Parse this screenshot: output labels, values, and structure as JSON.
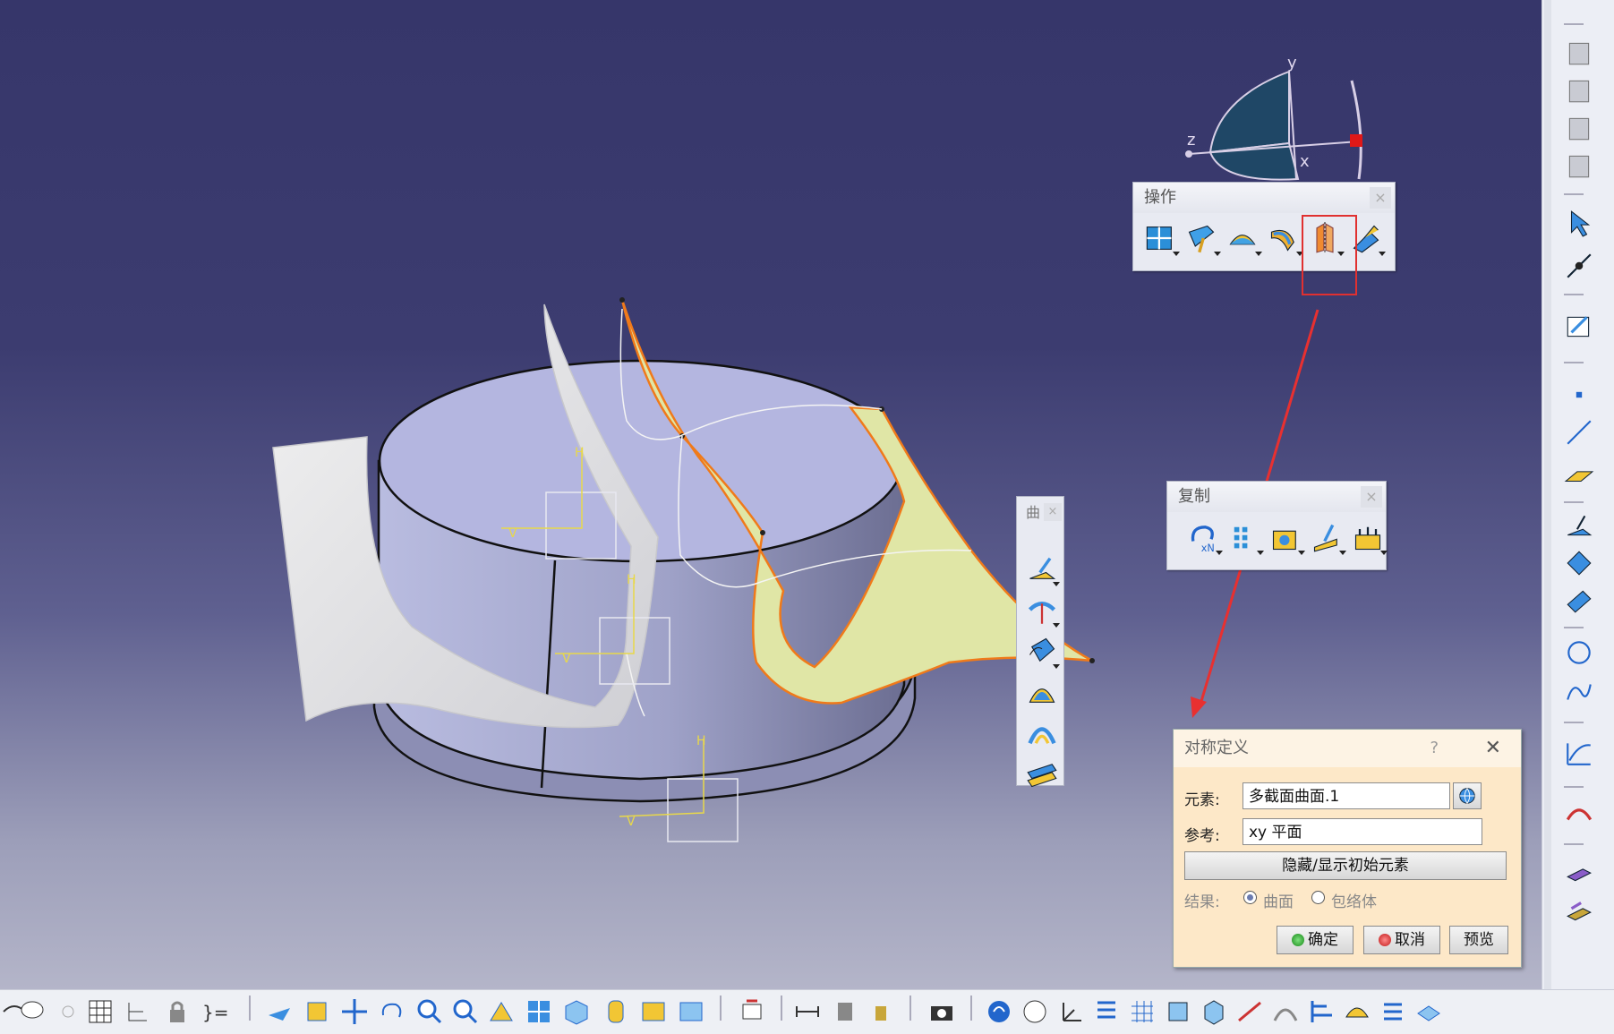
{
  "compass": {
    "y_label": "y",
    "z_label": "z",
    "x_label": "x"
  },
  "toolbars": {
    "operations": {
      "title": "操作",
      "close": "×",
      "icons": [
        "join-icon",
        "healing-icon",
        "extract-icon",
        "fillet-icon",
        "symmetry-icon",
        "transform-icon"
      ]
    },
    "replication": {
      "title": "复制",
      "close": "×",
      "icons": [
        "repetition-icon",
        "pattern-icon",
        "powercopy-icon",
        "instantiate-icon",
        "catalog-icon"
      ]
    },
    "curves": {
      "title": "曲",
      "close": "×",
      "icons": [
        "extrude-surface-icon",
        "revolve-surface-icon",
        "sweep-surface-icon",
        "fill-surface-icon",
        "multisection-surface-icon",
        "blend-surface-icon"
      ]
    }
  },
  "dialog": {
    "title": "对称定义",
    "help": "?",
    "close": "✕",
    "element_label": "元素:",
    "element_value": "多截面曲面.1",
    "reference_label": "参考:",
    "reference_value": "xy 平面",
    "toggle_button": "隐藏/显示初始元素",
    "result_label": "结果:",
    "result_option1": "曲面",
    "result_option2": "包络体",
    "ok_button": "确定",
    "cancel_button": "取消",
    "preview_button": "预览"
  },
  "colors": {
    "highlight": "#e03030",
    "arrow": "#e83030",
    "viewport_top": "#36366a",
    "viewport_bottom": "#b4b5c9",
    "dialog_bg": "#fde8c8"
  }
}
